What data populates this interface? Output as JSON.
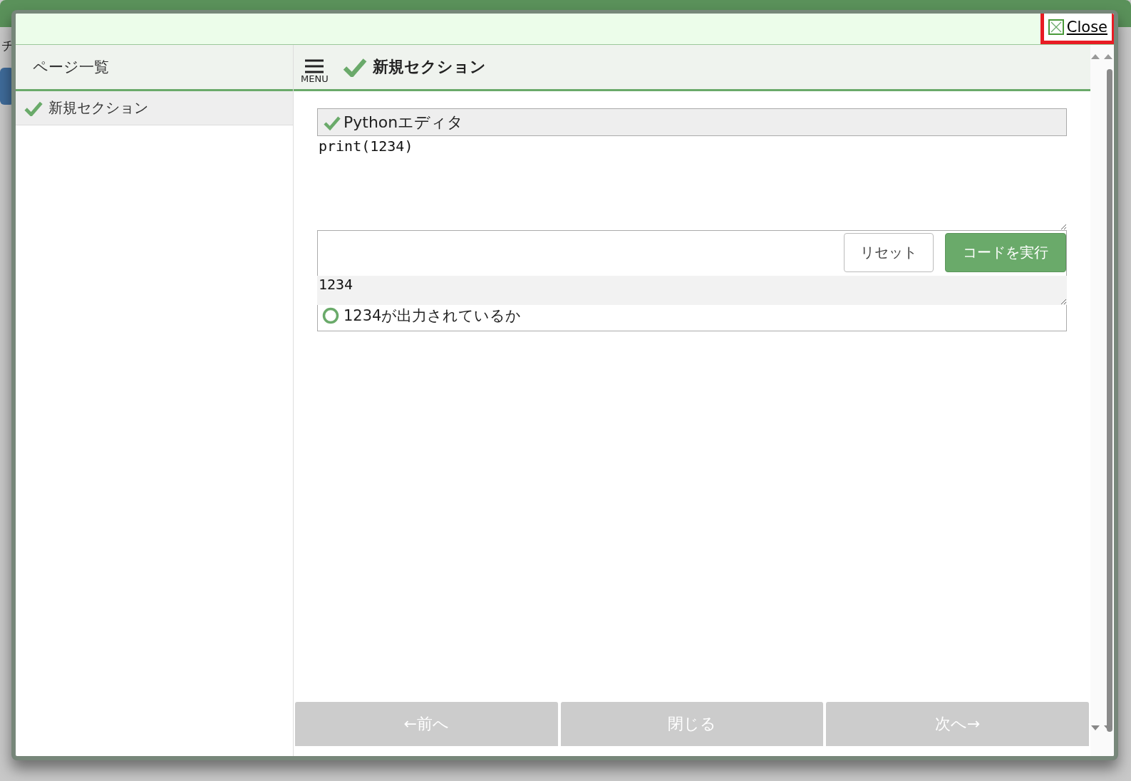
{
  "background": {
    "fragment": "チ"
  },
  "dialog": {
    "close_label": "Close"
  },
  "sidebar": {
    "title": "ページ一覧",
    "items": [
      {
        "label": "新規セクション",
        "completed": true,
        "selected": true
      }
    ]
  },
  "header": {
    "menu_label": "MENU",
    "title": "新規セクション",
    "completed": true
  },
  "editor": {
    "title": "Pythonエディタ",
    "completed": true,
    "code": "print(1234)",
    "buttons": [
      {
        "label": "リセット",
        "kind": "secondary"
      },
      {
        "label": "コードを実行",
        "kind": "primary"
      }
    ],
    "output": "1234",
    "checks": [
      {
        "label": "1234が出力されているか",
        "passed": true
      }
    ]
  },
  "nav": [
    {
      "label": "←前へ"
    },
    {
      "label": "閉じる"
    },
    {
      "label": "次へ→"
    }
  ]
}
